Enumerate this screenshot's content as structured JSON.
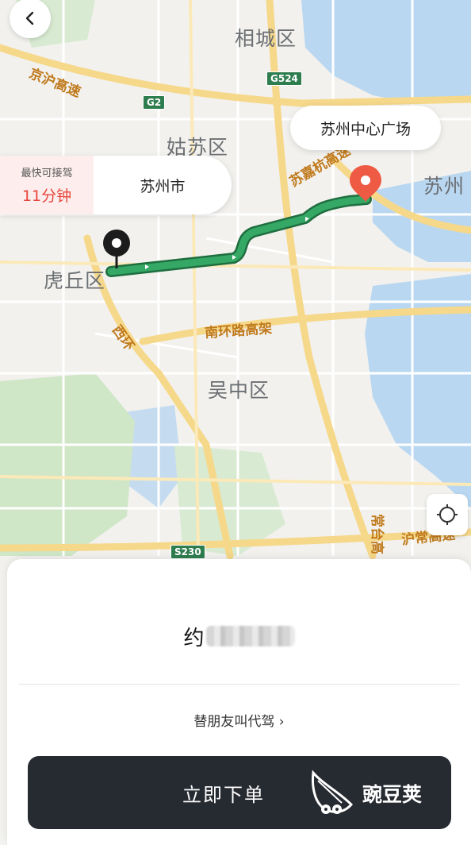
{
  "map": {
    "districts": [
      "相城区",
      "姑苏区",
      "虎丘区",
      "吴中区",
      "苏州"
    ],
    "roads": [
      "京沪高速",
      "苏嘉杭高速",
      "西环",
      "南环路高架",
      "常台高",
      "沪常高速"
    ],
    "route_labels": [
      "苏州中心广场"
    ],
    "shields": [
      "G524",
      "G2",
      "S230"
    ],
    "colors": {
      "route": "#2f9a57",
      "water": "#b9d7f0",
      "green_area": "#cfe6c7",
      "road": "#f6d88a"
    }
  },
  "back_button": {
    "icon": "chevron-left-icon"
  },
  "destination": {
    "label": "苏州中心广场",
    "marker_icon": "map-pin-icon",
    "marker_color": "#ee5a43"
  },
  "start": {
    "eta_label": "最快可接驾",
    "eta_value": "11分钟",
    "city": "苏州市",
    "marker_icon": "map-pin-icon"
  },
  "locate_button": {
    "icon": "locate-target-icon"
  },
  "sheet": {
    "price_prefix": "约",
    "friend_link": "替朋友叫代驾 ›",
    "order_button": "立即下单",
    "watermark_text": "豌豆荚"
  }
}
